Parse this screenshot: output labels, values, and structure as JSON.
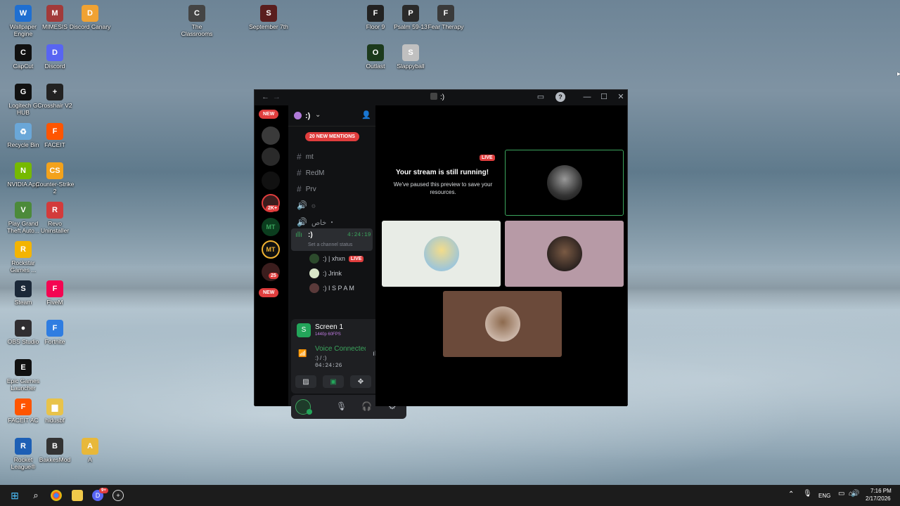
{
  "desktop": {
    "icons": [
      {
        "label": "Wallpaper Engine",
        "glyph": "W",
        "color": "#1f6fd1"
      },
      {
        "label": "MIMESIS",
        "glyph": "M",
        "color": "#a23a3a"
      },
      {
        "label": "Discord Canary",
        "glyph": "D",
        "color": "#f0a232"
      },
      {
        "label": "The Classrooms",
        "glyph": "C",
        "color": "#444444"
      },
      {
        "label": "September 7th",
        "glyph": "S",
        "color": "#5a1e1e"
      },
      {
        "label": "Floor 9",
        "glyph": "F",
        "color": "#222222"
      },
      {
        "label": "Psalm 59-13",
        "glyph": "P",
        "color": "#2a2a2a"
      },
      {
        "label": "Fear Therapy",
        "glyph": "F",
        "color": "#3a3a3a"
      },
      {
        "label": "CapCut",
        "glyph": "C",
        "color": "#111111"
      },
      {
        "label": "Discord",
        "glyph": "D",
        "color": "#5865f2"
      },
      {
        "label": "Outlast",
        "glyph": "O",
        "color": "#1c3a1c"
      },
      {
        "label": "Slappyball",
        "glyph": "S",
        "color": "#c0c0c0"
      },
      {
        "label": "Logitech G HUB",
        "glyph": "G",
        "color": "#111111"
      },
      {
        "label": "Crosshair V2",
        "glyph": "+",
        "color": "#222222"
      },
      {
        "label": "Recycle Bin",
        "glyph": "♻",
        "color": "#6aa7d8"
      },
      {
        "label": "FACEIT",
        "glyph": "F",
        "color": "#ff5500"
      },
      {
        "label": "NVIDIA App",
        "glyph": "N",
        "color": "#76b900"
      },
      {
        "label": "Counter-Strike 2",
        "glyph": "CS",
        "color": "#f3a21b"
      },
      {
        "label": "Play Grand Theft Auto...",
        "glyph": "V",
        "color": "#4c8a3a"
      },
      {
        "label": "Revo Uninstaller",
        "glyph": "R",
        "color": "#d33b3b"
      },
      {
        "label": "Rockstar Games ...",
        "glyph": "R",
        "color": "#f4b400"
      },
      {
        "label": "Steam",
        "glyph": "S",
        "color": "#1b2838"
      },
      {
        "label": "FiveM",
        "glyph": "F",
        "color": "#f40552"
      },
      {
        "label": "OBS Studio",
        "glyph": "●",
        "color": "#302e31"
      },
      {
        "label": "Fortnite",
        "glyph": "F",
        "color": "#2f7de1"
      },
      {
        "label": "Epic Games Launcher",
        "glyph": "E",
        "color": "#111111"
      },
      {
        "label": "FACEIT AC",
        "glyph": "F",
        "color": "#ff5500"
      },
      {
        "label": "hidusbf",
        "glyph": "▆",
        "color": "#e8c34a"
      },
      {
        "label": "Rocket League®",
        "glyph": "R",
        "color": "#1d5fb5"
      },
      {
        "label": "BakkesMod",
        "glyph": "B",
        "color": "#333333"
      },
      {
        "label": "A",
        "glyph": "A",
        "color": "#e8b83a"
      }
    ]
  },
  "window": {
    "title": ":)",
    "nav_back": "←",
    "nav_forward": "→",
    "inbox_icon": "▭",
    "help_icon": "?",
    "minimize": "—",
    "maximize": "☐",
    "close": "✕"
  },
  "guilds": {
    "new_top": "NEW",
    "badge_2k": "2K+",
    "mt_label": "MT",
    "badge_25": "25",
    "new_bottom": "NEW"
  },
  "server": {
    "name": ":)",
    "mentions": "20 NEW MENTIONS",
    "channels": [
      {
        "icon": "#",
        "name": "mt"
      },
      {
        "icon": "#",
        "name": "RedM"
      },
      {
        "icon": "#",
        "name": "Prv"
      },
      {
        "icon": "🔊",
        "name": "۞"
      },
      {
        "icon": "🔊",
        "name": "خاص ・"
      }
    ],
    "voice_channel": {
      "name": ":)",
      "time": "4:24:19",
      "status_placeholder": "Set a channel status"
    },
    "users": [
      {
        "name": ":) | xhxn",
        "live": "LIVE"
      },
      {
        "name": ":) Jrink",
        "live": ""
      },
      {
        "name": ":) I S P A M",
        "live": ""
      }
    ]
  },
  "stream_panel": {
    "title": "Screen 1",
    "quality": "1440p 60FPS",
    "voice_status": "Voice Connected",
    "voice_location": ":) / :)",
    "elapsed": "04:24:26"
  },
  "stage": {
    "live_badge": "LIVE",
    "stream_title": "Your stream is still running!",
    "stream_subtitle": "We've paused this preview to save your resources."
  },
  "taskbar": {
    "language": "ENG",
    "time": "7:16 PM",
    "date": "2/17/2026",
    "discord_badge": "9+"
  }
}
